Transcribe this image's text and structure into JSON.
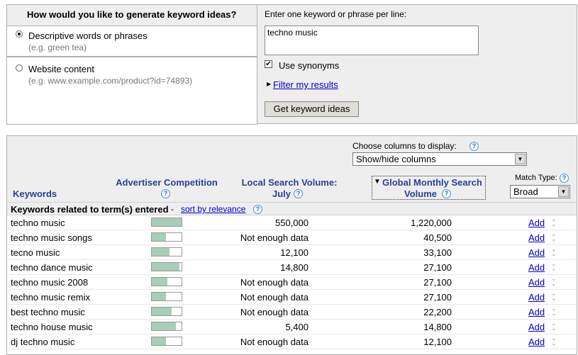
{
  "generate": {
    "question": "How would you like to generate keyword ideas?",
    "option1_label": "Descriptive words or phrases",
    "option1_hint": "(e.g. green tea)",
    "option2_label": "Website content",
    "option2_hint": "(e.g. www.example.com/product?id=74893)"
  },
  "entry": {
    "prompt": "Enter one keyword or phrase per line:",
    "value": "techno music",
    "synonyms_label": "Use synonyms",
    "synonyms_checked": true,
    "filter_link": "Filter my results",
    "submit_label": "Get keyword ideas"
  },
  "results": {
    "choose_columns_label": "Choose columns to display:",
    "columns_select": "Show/hide columns",
    "match_type_label": "Match Type:",
    "match_type_value": "Broad",
    "col_keywords": "Keywords",
    "col_competition_1": "Advertiser Competition",
    "col_local_1": "Local Search Volume:",
    "col_local_2": "July",
    "col_global_1": "Global Monthly Search",
    "col_global_2": "Volume",
    "sort_arrow": "▼",
    "section_title": "Keywords related to term(s) entered",
    "section_sep": " - ",
    "sort_link": "sort by relevance",
    "add_label": "Add",
    "rows": [
      {
        "keyword": "techno music",
        "competition": 1.0,
        "local": "550,000",
        "global": "1,220,000"
      },
      {
        "keyword": "techno music songs",
        "competition": 0.47,
        "local": "Not enough data",
        "global": "40,500"
      },
      {
        "keyword": "tecno music",
        "competition": 0.6,
        "local": "12,100",
        "global": "33,100"
      },
      {
        "keyword": "techno dance music",
        "competition": 0.93,
        "local": "14,800",
        "global": "27,100"
      },
      {
        "keyword": "techno music 2008",
        "competition": 0.53,
        "local": "Not enough data",
        "global": "27,100"
      },
      {
        "keyword": "techno music remix",
        "competition": 0.47,
        "local": "Not enough data",
        "global": "27,100"
      },
      {
        "keyword": "best techno music",
        "competition": 0.67,
        "local": "Not enough data",
        "global": "22,200"
      },
      {
        "keyword": "techno house music",
        "competition": 0.8,
        "local": "5,400",
        "global": "14,800"
      },
      {
        "keyword": "dj techno music",
        "competition": 0.47,
        "local": "Not enough data",
        "global": "12,100"
      }
    ]
  }
}
